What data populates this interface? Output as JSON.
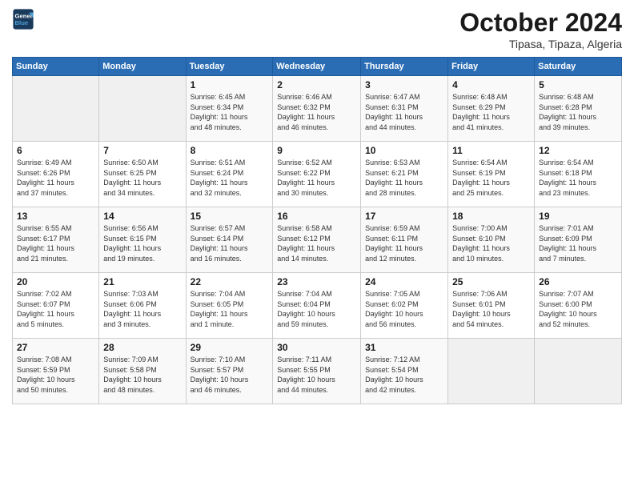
{
  "logo": {
    "line1": "General",
    "line2": "Blue"
  },
  "title": "October 2024",
  "location": "Tipasa, Tipaza, Algeria",
  "headers": [
    "Sunday",
    "Monday",
    "Tuesday",
    "Wednesday",
    "Thursday",
    "Friday",
    "Saturday"
  ],
  "weeks": [
    [
      {
        "day": "",
        "info": ""
      },
      {
        "day": "",
        "info": ""
      },
      {
        "day": "1",
        "info": "Sunrise: 6:45 AM\nSunset: 6:34 PM\nDaylight: 11 hours\nand 48 minutes."
      },
      {
        "day": "2",
        "info": "Sunrise: 6:46 AM\nSunset: 6:32 PM\nDaylight: 11 hours\nand 46 minutes."
      },
      {
        "day": "3",
        "info": "Sunrise: 6:47 AM\nSunset: 6:31 PM\nDaylight: 11 hours\nand 44 minutes."
      },
      {
        "day": "4",
        "info": "Sunrise: 6:48 AM\nSunset: 6:29 PM\nDaylight: 11 hours\nand 41 minutes."
      },
      {
        "day": "5",
        "info": "Sunrise: 6:48 AM\nSunset: 6:28 PM\nDaylight: 11 hours\nand 39 minutes."
      }
    ],
    [
      {
        "day": "6",
        "info": "Sunrise: 6:49 AM\nSunset: 6:26 PM\nDaylight: 11 hours\nand 37 minutes."
      },
      {
        "day": "7",
        "info": "Sunrise: 6:50 AM\nSunset: 6:25 PM\nDaylight: 11 hours\nand 34 minutes."
      },
      {
        "day": "8",
        "info": "Sunrise: 6:51 AM\nSunset: 6:24 PM\nDaylight: 11 hours\nand 32 minutes."
      },
      {
        "day": "9",
        "info": "Sunrise: 6:52 AM\nSunset: 6:22 PM\nDaylight: 11 hours\nand 30 minutes."
      },
      {
        "day": "10",
        "info": "Sunrise: 6:53 AM\nSunset: 6:21 PM\nDaylight: 11 hours\nand 28 minutes."
      },
      {
        "day": "11",
        "info": "Sunrise: 6:54 AM\nSunset: 6:19 PM\nDaylight: 11 hours\nand 25 minutes."
      },
      {
        "day": "12",
        "info": "Sunrise: 6:54 AM\nSunset: 6:18 PM\nDaylight: 11 hours\nand 23 minutes."
      }
    ],
    [
      {
        "day": "13",
        "info": "Sunrise: 6:55 AM\nSunset: 6:17 PM\nDaylight: 11 hours\nand 21 minutes."
      },
      {
        "day": "14",
        "info": "Sunrise: 6:56 AM\nSunset: 6:15 PM\nDaylight: 11 hours\nand 19 minutes."
      },
      {
        "day": "15",
        "info": "Sunrise: 6:57 AM\nSunset: 6:14 PM\nDaylight: 11 hours\nand 16 minutes."
      },
      {
        "day": "16",
        "info": "Sunrise: 6:58 AM\nSunset: 6:12 PM\nDaylight: 11 hours\nand 14 minutes."
      },
      {
        "day": "17",
        "info": "Sunrise: 6:59 AM\nSunset: 6:11 PM\nDaylight: 11 hours\nand 12 minutes."
      },
      {
        "day": "18",
        "info": "Sunrise: 7:00 AM\nSunset: 6:10 PM\nDaylight: 11 hours\nand 10 minutes."
      },
      {
        "day": "19",
        "info": "Sunrise: 7:01 AM\nSunset: 6:09 PM\nDaylight: 11 hours\nand 7 minutes."
      }
    ],
    [
      {
        "day": "20",
        "info": "Sunrise: 7:02 AM\nSunset: 6:07 PM\nDaylight: 11 hours\nand 5 minutes."
      },
      {
        "day": "21",
        "info": "Sunrise: 7:03 AM\nSunset: 6:06 PM\nDaylight: 11 hours\nand 3 minutes."
      },
      {
        "day": "22",
        "info": "Sunrise: 7:04 AM\nSunset: 6:05 PM\nDaylight: 11 hours\nand 1 minute."
      },
      {
        "day": "23",
        "info": "Sunrise: 7:04 AM\nSunset: 6:04 PM\nDaylight: 10 hours\nand 59 minutes."
      },
      {
        "day": "24",
        "info": "Sunrise: 7:05 AM\nSunset: 6:02 PM\nDaylight: 10 hours\nand 56 minutes."
      },
      {
        "day": "25",
        "info": "Sunrise: 7:06 AM\nSunset: 6:01 PM\nDaylight: 10 hours\nand 54 minutes."
      },
      {
        "day": "26",
        "info": "Sunrise: 7:07 AM\nSunset: 6:00 PM\nDaylight: 10 hours\nand 52 minutes."
      }
    ],
    [
      {
        "day": "27",
        "info": "Sunrise: 7:08 AM\nSunset: 5:59 PM\nDaylight: 10 hours\nand 50 minutes."
      },
      {
        "day": "28",
        "info": "Sunrise: 7:09 AM\nSunset: 5:58 PM\nDaylight: 10 hours\nand 48 minutes."
      },
      {
        "day": "29",
        "info": "Sunrise: 7:10 AM\nSunset: 5:57 PM\nDaylight: 10 hours\nand 46 minutes."
      },
      {
        "day": "30",
        "info": "Sunrise: 7:11 AM\nSunset: 5:55 PM\nDaylight: 10 hours\nand 44 minutes."
      },
      {
        "day": "31",
        "info": "Sunrise: 7:12 AM\nSunset: 5:54 PM\nDaylight: 10 hours\nand 42 minutes."
      },
      {
        "day": "",
        "info": ""
      },
      {
        "day": "",
        "info": ""
      }
    ]
  ]
}
